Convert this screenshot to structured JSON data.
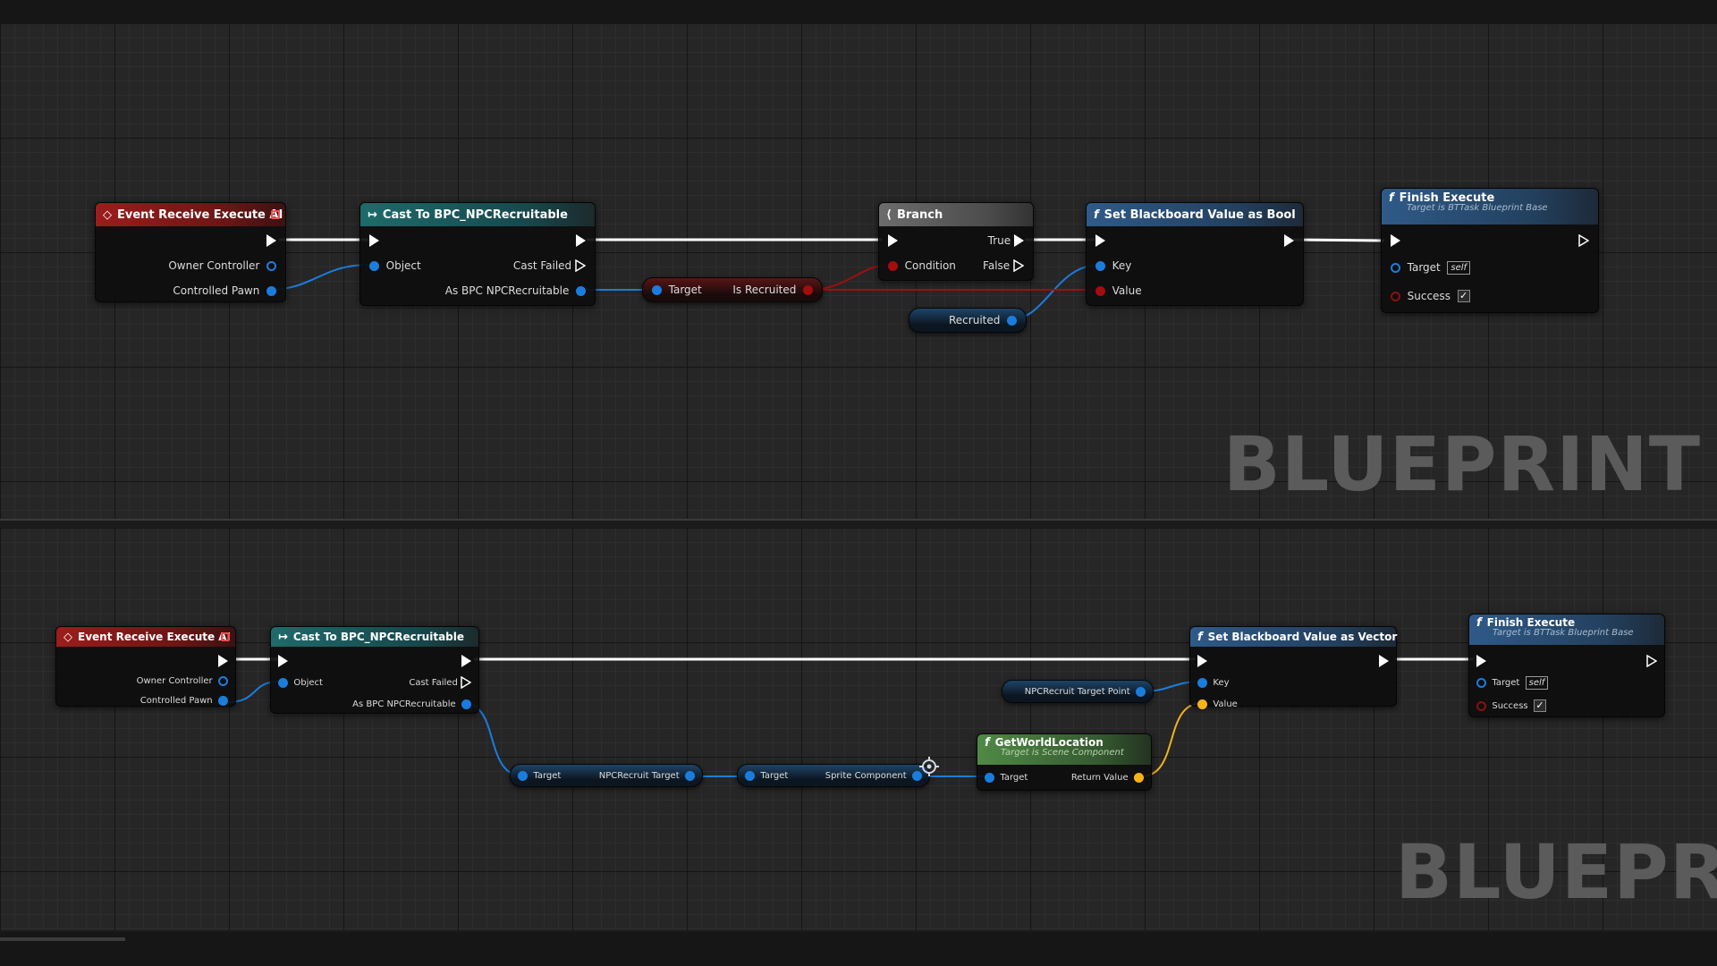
{
  "watermark": "BLUEPRINT",
  "watermark_cropped": "BLUEPRIN",
  "graph1": {
    "event": {
      "title": "Event Receive Execute AI",
      "pins": [
        "Owner Controller",
        "Controlled Pawn"
      ]
    },
    "cast": {
      "title": "Cast To BPC_NPCRecruitable",
      "object": "Object",
      "cast_failed": "Cast Failed",
      "as": "As BPC NPCRecruitable"
    },
    "getter": {
      "target": "Target",
      "output": "Is Recruited"
    },
    "branch": {
      "title": "Branch",
      "true": "True",
      "false": "False",
      "condition": "Condition"
    },
    "recruited_var": "Recruited",
    "set_bb": {
      "title": "Set Blackboard Value as Bool",
      "key": "Key",
      "value": "Value"
    },
    "finish": {
      "title": "Finish Execute",
      "subtitle": "Target is BTTask Blueprint Base",
      "target": "Target",
      "self": "self",
      "success": "Success",
      "success_checked": true
    }
  },
  "graph2": {
    "event": {
      "title": "Event Receive Execute AI",
      "pins": [
        "Owner Controller",
        "Controlled Pawn"
      ]
    },
    "cast": {
      "title": "Cast To BPC_NPCRecruitable",
      "object": "Object",
      "cast_failed": "Cast Failed",
      "as": "As BPC NPCRecruitable"
    },
    "getter1": {
      "target": "Target",
      "output": "NPCRecruit Target"
    },
    "getter2": {
      "target": "Target",
      "output": "Sprite Component"
    },
    "getworld": {
      "title": "GetWorldLocation",
      "subtitle": "Target is Scene Component",
      "target": "Target",
      "return": "Return Value"
    },
    "target_point_var": "NPCRecruit Target Point",
    "set_bb": {
      "title": "Set Blackboard Value as Vector",
      "key": "Key",
      "value": "Value"
    },
    "finish": {
      "title": "Finish Execute",
      "subtitle": "Target is BTTask Blueprint Base",
      "target": "Target",
      "self": "self",
      "success": "Success",
      "success_checked": true
    }
  },
  "icons": {
    "event": "event-diamond-icon",
    "cast": "cast-arrows-icon",
    "func": "function-f-icon",
    "branch": "branch-icon"
  },
  "colors": {
    "exec_wire": "#ffffff",
    "object_wire": "#1a7dde",
    "bool_wire": "#a30d0d",
    "vector_wire": "#f3b41a"
  }
}
